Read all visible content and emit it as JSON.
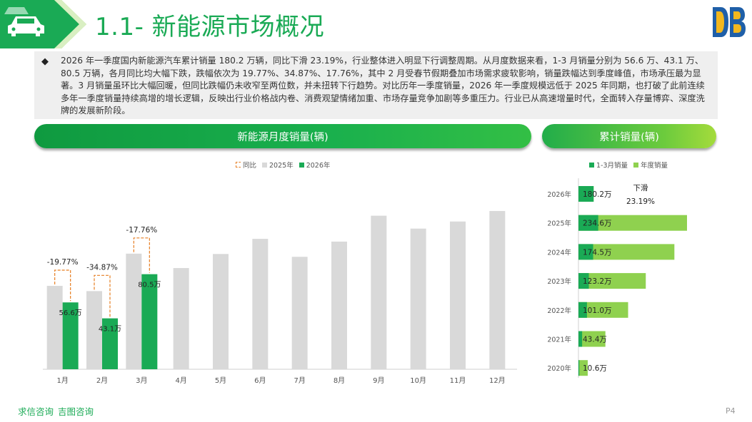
{
  "header": {
    "title": "1.1- 新能源市场概况",
    "car_icon": "car-icon",
    "logo_icon": "db-logo-icon",
    "colors": {
      "accent": "#1aaa55",
      "light_green": "#8fd14f"
    }
  },
  "summary": {
    "bullet": "◆",
    "text": "2026 年一季度国内新能源汽车累计销量 180.2 万辆，同比下滑 23.19%，行业整体进入明显下行调整周期。从月度数据来看，1-3 月销量分别为 56.6 万、43.1 万、80.5 万辆，各月同比均大幅下跌，跌幅依次为 19.77%、34.87%、17.76%，其中 2 月受春节假期叠加市场需求疲软影响，销量跌幅达到季度峰值，市场承压最为显著。3 月销量虽环比大幅回暖，但同比跌幅仍未收窄至两位数，并未扭转下行趋势。对比历年一季度销量，2026 年一季度规模远低于 2025 年同期，也打破了此前连续多年一季度销量持续高增的增长逻辑，反映出行业价格战内卷、消费观望情绪加重、市场存量竞争加剧等多重压力。行业已从高速增量时代，全面转入存量博弈、深度洗牌的发展新阶段。"
  },
  "left_panel": {
    "title": "新能源月度销量(辆)"
  },
  "right_panel": {
    "title": "累计销量(辆)"
  },
  "chart_data": [
    {
      "type": "bar",
      "title": "新能源月度销量(辆)",
      "categories": [
        "1月",
        "2月",
        "3月",
        "4月",
        "5月",
        "6月",
        "7月",
        "8月",
        "9月",
        "10月",
        "11月",
        "12月"
      ],
      "series": [
        {
          "name": "2025年",
          "color": "#d9d9d9",
          "values": [
            70.6,
            66.2,
            97.9,
            85.7,
            97.6,
            110.4,
            95.2,
            108.1,
            130.0,
            119.1,
            125.1,
            134.0
          ]
        },
        {
          "name": "2026年",
          "color": "#1aaa55",
          "values": [
            56.6,
            43.1,
            80.5,
            null,
            null,
            null,
            null,
            null,
            null,
            null,
            null,
            null
          ]
        }
      ],
      "data_labels": [
        "56.6万",
        "43.1万",
        "80.5万"
      ],
      "yoy": {
        "name": "同比",
        "color": "#e67e22",
        "labels": [
          "-19.77%",
          "-34.87%",
          "-17.76%"
        ]
      },
      "ylim": [
        0,
        140
      ],
      "legend": [
        "同比",
        "2025年",
        "2026年"
      ],
      "legend_position": "top-center",
      "grid": false
    },
    {
      "type": "bar",
      "orientation": "horizontal",
      "title": "累计销量(辆)",
      "categories": [
        "2026年",
        "2025年",
        "2024年",
        "2023年",
        "2022年",
        "2021年",
        "2020年"
      ],
      "series": [
        {
          "name": "1-3月销量",
          "color": "#1aaa55",
          "values": [
            180.2,
            234.6,
            174.5,
            123.2,
            101.0,
            43.4,
            10.6
          ]
        },
        {
          "name": "年度销量",
          "color": "#8fd14f",
          "values": [
            180.2,
            1290.0,
            1140.0,
            800.0,
            590.0,
            320.0,
            110.0
          ]
        }
      ],
      "data_labels": [
        "180.2万",
        "234.6万",
        "174.5万",
        "123.2万",
        "101.0万",
        "43.4万",
        "10.6万"
      ],
      "annotation": {
        "line1": "下滑",
        "line2": "23.19%"
      },
      "xlim": [
        0,
        1300
      ],
      "legend": [
        "1-3月销量",
        "年度销量"
      ],
      "legend_position": "top-center",
      "grid": false
    }
  ],
  "footer": {
    "brand1": "求信咨询",
    "brand2": "吉图咨询",
    "page": "P4"
  }
}
